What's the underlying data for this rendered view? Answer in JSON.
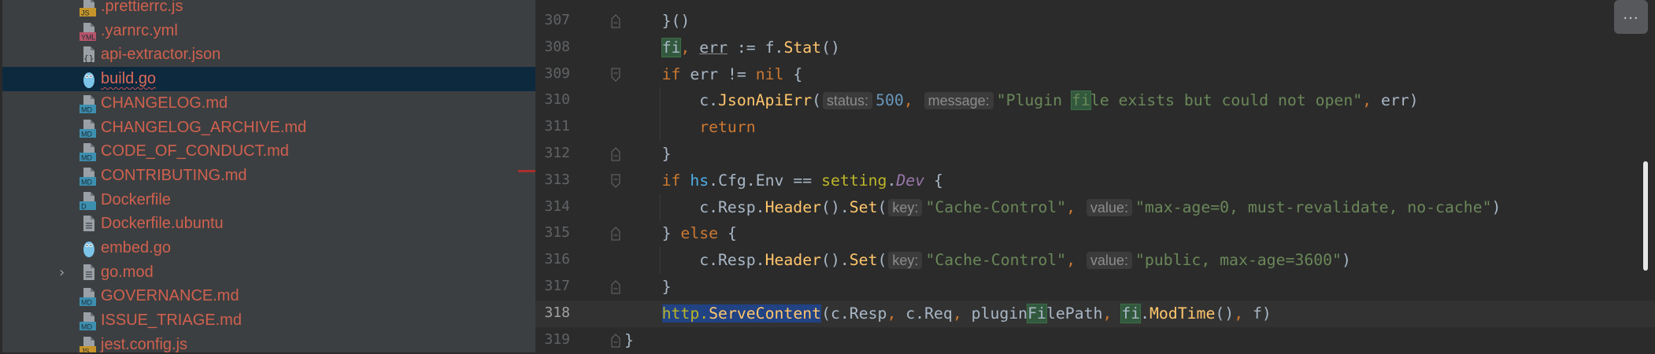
{
  "colors": {
    "sidebar_bg": "#3c3f41",
    "editor_bg": "#2b2b2b",
    "selection_row": "#0d293e",
    "file_unversioned": "#d0614f",
    "keyword": "#cc7832",
    "string": "#6a8759",
    "number": "#6897bb",
    "function": "#ffc66d",
    "selection": "#214283",
    "usage_highlight": "#32593d"
  },
  "project_tree": {
    "items": [
      {
        "name": ".prettierrc.js",
        "icon": "js-file-icon",
        "badge": "JS",
        "badge_color": "#c6942a"
      },
      {
        "name": ".yarnrc.yml",
        "icon": "yaml-file-icon",
        "badge": "YML",
        "badge_color": "#b5546a"
      },
      {
        "name": "api-extractor.json",
        "icon": "json-file-icon",
        "badge": "{}",
        "badge_color": ""
      },
      {
        "name": "build.go",
        "icon": "go-gopher-icon",
        "selected": true
      },
      {
        "name": "CHANGELOG.md",
        "icon": "markdown-file-icon",
        "badge": "MD",
        "badge_color": "#3d8fb0"
      },
      {
        "name": "CHANGELOG_ARCHIVE.md",
        "icon": "markdown-file-icon",
        "badge": "MD",
        "badge_color": "#3d8fb0"
      },
      {
        "name": "CODE_OF_CONDUCT.md",
        "icon": "markdown-file-icon",
        "badge": "MD",
        "badge_color": "#3d8fb0"
      },
      {
        "name": "CONTRIBUTING.md",
        "icon": "markdown-file-icon",
        "badge": "MD",
        "badge_color": "#3d8fb0"
      },
      {
        "name": "Dockerfile",
        "icon": "docker-file-icon",
        "badge": "D",
        "badge_color": "#3d8fb0"
      },
      {
        "name": "Dockerfile.ubuntu",
        "icon": "text-file-icon"
      },
      {
        "name": "embed.go",
        "icon": "go-gopher-icon"
      },
      {
        "name": "go.mod",
        "icon": "text-file-icon",
        "expandable": true
      },
      {
        "name": "GOVERNANCE.md",
        "icon": "markdown-file-icon",
        "badge": "MD",
        "badge_color": "#3d8fb0"
      },
      {
        "name": "ISSUE_TRIAGE.md",
        "icon": "markdown-file-icon",
        "badge": "MD",
        "badge_color": "#3d8fb0"
      },
      {
        "name": "jest.config.js",
        "icon": "js-file-icon",
        "badge": "JS",
        "badge_color": "#c6942a"
      }
    ]
  },
  "editor": {
    "current_line": 318,
    "more_button": "...",
    "lines": [
      {
        "n": "307",
        "fold": "end",
        "indent": 1,
        "tokens": [
          {
            "t": "}()"
          }
        ]
      },
      {
        "n": "308",
        "indent": 1,
        "tokens": [
          {
            "t": "fi",
            "c": "hl"
          },
          {
            "t": ", ",
            "c": "comma"
          },
          {
            "t": "err",
            "c": "ul"
          },
          {
            "t": " := f."
          },
          {
            "t": "Stat",
            "c": "fn"
          },
          {
            "t": "()"
          }
        ]
      },
      {
        "n": "309",
        "fold": "start",
        "indent": 1,
        "tokens": [
          {
            "t": "if",
            "c": "kw"
          },
          {
            "t": " err != "
          },
          {
            "t": "nil",
            "c": "kw"
          },
          {
            "t": " {"
          }
        ]
      },
      {
        "n": "310",
        "indent": 2,
        "guide": true,
        "tokens": [
          {
            "t": "c."
          },
          {
            "t": "JsonApiErr",
            "c": "fn"
          },
          {
            "t": "("
          },
          {
            "t": "status:",
            "c": "hint"
          },
          {
            "t": "500",
            "c": "num"
          },
          {
            "t": ", ",
            "c": "comma"
          },
          {
            "t": "message:",
            "c": "hint"
          },
          {
            "t": "\"Plugin ",
            "c": "str"
          },
          {
            "t": "fi",
            "c": "str hl"
          },
          {
            "t": "le exists but could not open\"",
            "c": "str"
          },
          {
            "t": ", ",
            "c": "comma"
          },
          {
            "t": "err)"
          }
        ]
      },
      {
        "n": "311",
        "indent": 2,
        "guide": true,
        "tokens": [
          {
            "t": "return",
            "c": "kw"
          }
        ]
      },
      {
        "n": "312",
        "fold": "end",
        "indent": 1,
        "tokens": [
          {
            "t": "}"
          }
        ]
      },
      {
        "n": "313",
        "fold": "start",
        "indent": 1,
        "tokens": [
          {
            "t": "if",
            "c": "kw"
          },
          {
            "t": " "
          },
          {
            "t": "hs",
            "c": "pkg"
          },
          {
            "t": ".Cfg.Env == "
          },
          {
            "t": "setting",
            "c": "pkg2"
          },
          {
            "t": "."
          },
          {
            "t": "Dev",
            "c": "const"
          },
          {
            "t": " {"
          }
        ]
      },
      {
        "n": "314",
        "indent": 2,
        "guide": true,
        "tokens": [
          {
            "t": "c.Resp."
          },
          {
            "t": "Header",
            "c": "fn"
          },
          {
            "t": "()."
          },
          {
            "t": "Set",
            "c": "fn"
          },
          {
            "t": "("
          },
          {
            "t": "key:",
            "c": "hint"
          },
          {
            "t": "\"Cache-Control\"",
            "c": "str"
          },
          {
            "t": ", ",
            "c": "comma"
          },
          {
            "t": "value:",
            "c": "hint"
          },
          {
            "t": "\"max-age=0, must-revalidate, no-cache\"",
            "c": "str"
          },
          {
            "t": ")"
          }
        ]
      },
      {
        "n": "315",
        "fold": "end",
        "indent": 1,
        "tokens": [
          {
            "t": "} "
          },
          {
            "t": "else",
            "c": "kw"
          },
          {
            "t": " {"
          }
        ]
      },
      {
        "n": "316",
        "indent": 2,
        "guide": true,
        "tokens": [
          {
            "t": "c.Resp."
          },
          {
            "t": "Header",
            "c": "fn"
          },
          {
            "t": "()."
          },
          {
            "t": "Set",
            "c": "fn"
          },
          {
            "t": "("
          },
          {
            "t": "key:",
            "c": "hint"
          },
          {
            "t": "\"Cache-Control\"",
            "c": "str"
          },
          {
            "t": ", ",
            "c": "comma"
          },
          {
            "t": "value:",
            "c": "hint"
          },
          {
            "t": "\"public, max-age=3600\"",
            "c": "str"
          },
          {
            "t": ")"
          }
        ]
      },
      {
        "n": "317",
        "fold": "end",
        "indent": 1,
        "tokens": [
          {
            "t": "}"
          }
        ]
      },
      {
        "n": "318",
        "indent": 1,
        "tokens": [
          {
            "t": "http.",
            "c": "sel pkg2"
          },
          {
            "t": "ServeContent",
            "c": "sel fn"
          },
          {
            "t": "(c.Resp"
          },
          {
            "t": ", ",
            "c": "comma"
          },
          {
            "t": "c.Req"
          },
          {
            "t": ", ",
            "c": "comma"
          },
          {
            "t": "plugin"
          },
          {
            "t": "Fi",
            "c": "hl"
          },
          {
            "t": "lePath"
          },
          {
            "t": ", ",
            "c": "comma"
          },
          {
            "t": "fi",
            "c": "hl"
          },
          {
            "t": "."
          },
          {
            "t": "ModTime",
            "c": "fn"
          },
          {
            "t": "()"
          },
          {
            "t": ", ",
            "c": "comma"
          },
          {
            "t": "f)"
          }
        ]
      },
      {
        "n": "319",
        "fold": "end",
        "indent": 0,
        "tokens": [
          {
            "t": "}"
          }
        ]
      }
    ]
  }
}
